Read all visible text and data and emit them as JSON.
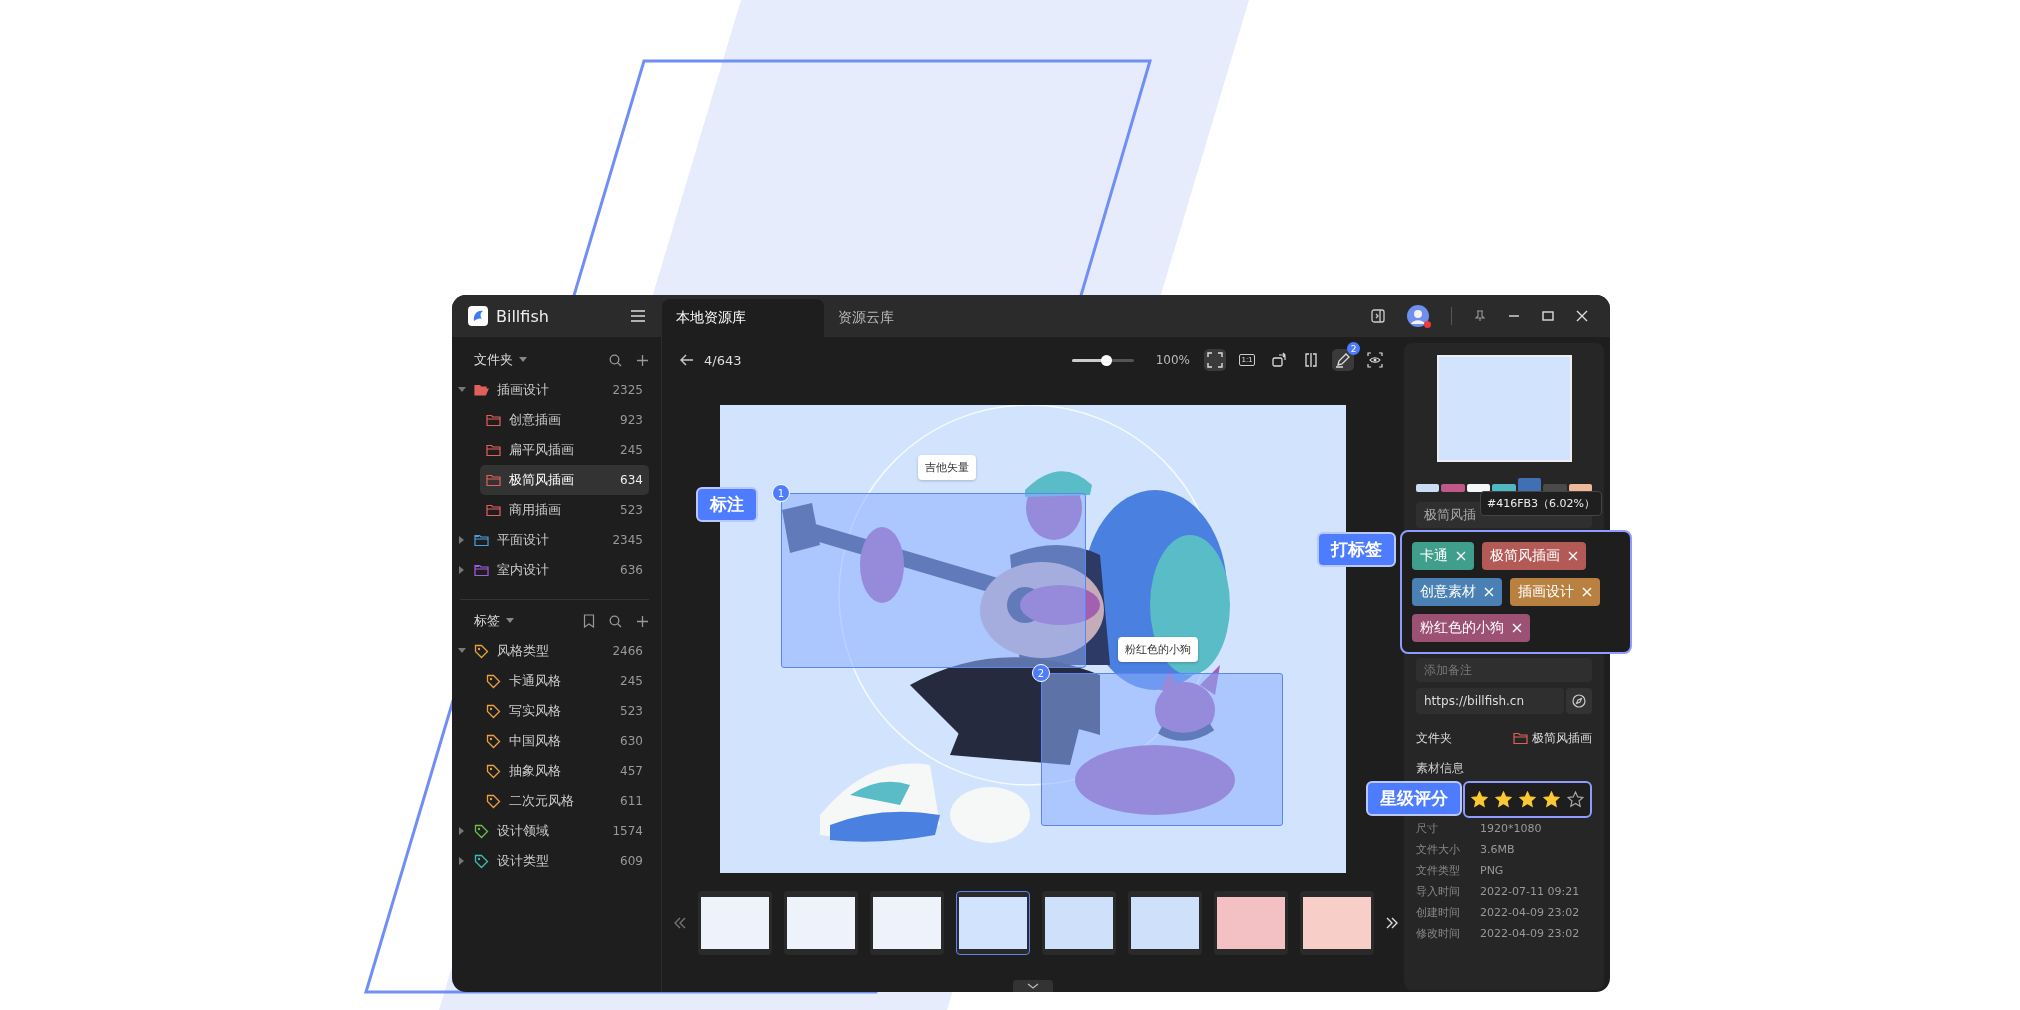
{
  "app": {
    "name": "Billfish"
  },
  "tabs": [
    {
      "label": "本地资源库",
      "selected": true
    },
    {
      "label": "资源云库",
      "selected": false
    }
  ],
  "titlebar": {
    "avatar_alert": true
  },
  "sidebar": {
    "folders": {
      "title": "文件夹",
      "items": [
        {
          "name": "插画设计",
          "count": "2325",
          "color": "#e0605c",
          "expanded": true,
          "selected": false,
          "children": [
            {
              "name": "创意插画",
              "count": "923",
              "color": "#e0605c",
              "selected": false
            },
            {
              "name": "扁平风插画",
              "count": "245",
              "color": "#e0605c",
              "selected": false
            },
            {
              "name": "极简风插画",
              "count": "634",
              "color": "#e0605c",
              "selected": true
            },
            {
              "name": "商用插画",
              "count": "523",
              "color": "#e0605c",
              "selected": false
            }
          ]
        },
        {
          "name": "平面设计",
          "count": "2345",
          "color": "#4a9fe0",
          "expanded": false,
          "selected": false
        },
        {
          "name": "室内设计",
          "count": "636",
          "color": "#a35de0",
          "expanded": false,
          "selected": false
        }
      ]
    },
    "tags": {
      "title": "标签",
      "items": [
        {
          "name": "风格类型",
          "count": "2466",
          "color": "#e8a040",
          "expanded": true,
          "selected": false,
          "children": [
            {
              "name": "卡通风格",
              "count": "245",
              "color": "#e8a040",
              "selected": false
            },
            {
              "name": "写实风格",
              "count": "523",
              "color": "#e8a040",
              "selected": false
            },
            {
              "name": "中国风格",
              "count": "630",
              "color": "#e8a040",
              "selected": false
            },
            {
              "name": "抽象风格",
              "count": "457",
              "color": "#e8a040",
              "selected": false
            },
            {
              "name": "二次元风格",
              "count": "611",
              "color": "#e8a040",
              "selected": false
            }
          ]
        },
        {
          "name": "设计领域",
          "count": "1574",
          "color": "#6cc04a",
          "expanded": false,
          "selected": false
        },
        {
          "name": "设计类型",
          "count": "609",
          "color": "#3cbfb0",
          "expanded": false,
          "selected": false
        }
      ]
    }
  },
  "viewer": {
    "position": "4/643",
    "zoom": {
      "level": 0.55,
      "reading": "100%"
    },
    "tools": [
      {
        "kind": "fit",
        "active": true
      },
      {
        "kind": "actual",
        "label": "1:1",
        "active": false
      },
      {
        "kind": "rotate",
        "active": false
      },
      {
        "kind": "compare",
        "active": false
      },
      {
        "kind": "annotate",
        "active": true,
        "badge": "2"
      },
      {
        "kind": "inspect",
        "active": false
      }
    ],
    "annotations": [
      {
        "number": "1",
        "label": "吉他矢量"
      },
      {
        "number": "2",
        "label": "粉红色的小狗"
      }
    ]
  },
  "filmstrip": {
    "thumbnails": [
      {
        "selected": false
      },
      {
        "selected": false
      },
      {
        "selected": false
      },
      {
        "selected": true
      },
      {
        "selected": false
      },
      {
        "selected": false
      },
      {
        "selected": false
      },
      {
        "selected": false
      }
    ]
  },
  "inspector": {
    "palette": [
      {
        "color": "#c9ddf7",
        "selected": false
      },
      {
        "color": "#c0588a",
        "selected": false
      },
      {
        "color": "#f4f6f8",
        "selected": false
      },
      {
        "color": "#4fb8c4",
        "selected": false
      },
      {
        "color": "#416fb3",
        "selected": true
      },
      {
        "color": "#4a4a4a",
        "selected": false
      },
      {
        "color": "#f0b896",
        "selected": false
      }
    ],
    "color_tooltip": "#416FB3（6.02%）",
    "name_value": "极简风插",
    "tags": [
      {
        "label": "卡通",
        "color": "#3f9f8c"
      },
      {
        "label": "极简风插画",
        "color": "#b35a57"
      },
      {
        "label": "创意素材",
        "color": "#4a80b3"
      },
      {
        "label": "插画设计",
        "color": "#b98140"
      },
      {
        "label": "粉红色的小狗",
        "color": "#9c5073"
      }
    ],
    "note_placeholder": "添加备注",
    "url": "https://billfish.cn",
    "folder": {
      "label": "文件夹",
      "value": "极简风插画"
    },
    "info_title": "素材信息",
    "stars": 4,
    "info": [
      {
        "label": "尺寸",
        "value": "1920*1080"
      },
      {
        "label": "文件大小",
        "value": "3.6MB"
      },
      {
        "label": "文件类型",
        "value": "PNG"
      },
      {
        "label": "导入时间",
        "value": "2022-07-11 09:21"
      },
      {
        "label": "创建时间",
        "value": "2022-04-09 23:02"
      },
      {
        "label": "修改时间",
        "value": "2022-04-09 23:02"
      }
    ]
  },
  "callouts": [
    {
      "kind": "annotate",
      "text": "标注"
    },
    {
      "kind": "tags",
      "text": "打标签"
    },
    {
      "kind": "rating",
      "text": "星级评分"
    }
  ]
}
